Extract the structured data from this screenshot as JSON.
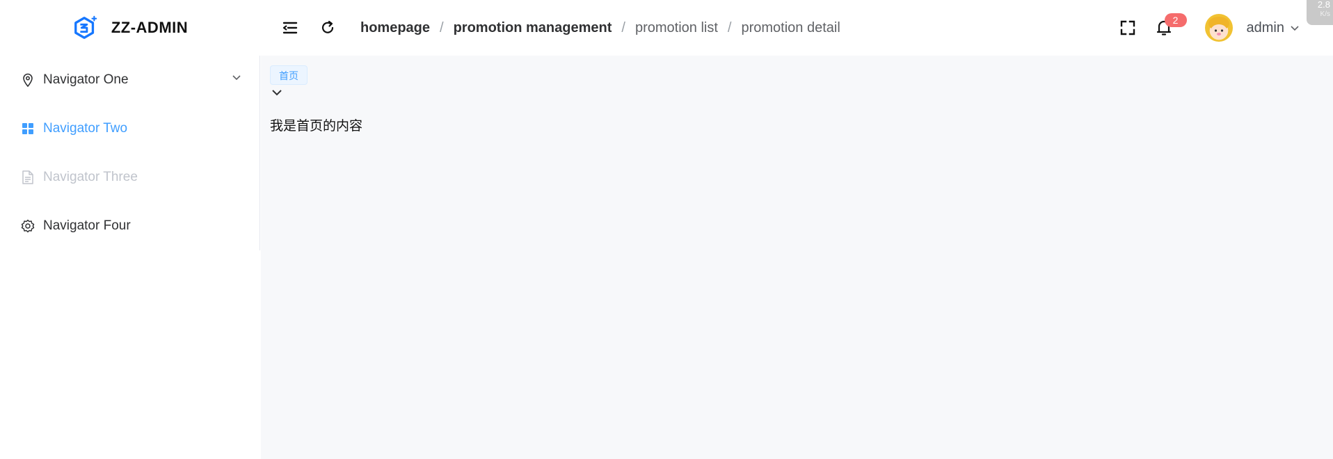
{
  "app": {
    "title": "ZZ-ADMIN"
  },
  "breadcrumb": [
    "homepage",
    "promotion management",
    "promotion list",
    "promotion detail"
  ],
  "header": {
    "notification_count": "2",
    "user_name": "admin"
  },
  "corner_widget": {
    "value": "2.8",
    "unit": "K/s"
  },
  "sidebar": {
    "items": [
      {
        "label": "Navigator One",
        "icon": "location-icon",
        "state": "normal",
        "has_submenu": true
      },
      {
        "label": "Navigator Two",
        "icon": "grid-icon",
        "state": "active",
        "has_submenu": false
      },
      {
        "label": "Navigator Three",
        "icon": "document-icon",
        "state": "disabled",
        "has_submenu": false
      },
      {
        "label": "Navigator Four",
        "icon": "gear-icon",
        "state": "normal",
        "has_submenu": false
      }
    ]
  },
  "main": {
    "tag_label": "首页",
    "content": "我是首页的内容"
  },
  "colors": {
    "accent": "#409eff",
    "badge": "#f56c6c",
    "main_bg": "#f7f8fa"
  }
}
